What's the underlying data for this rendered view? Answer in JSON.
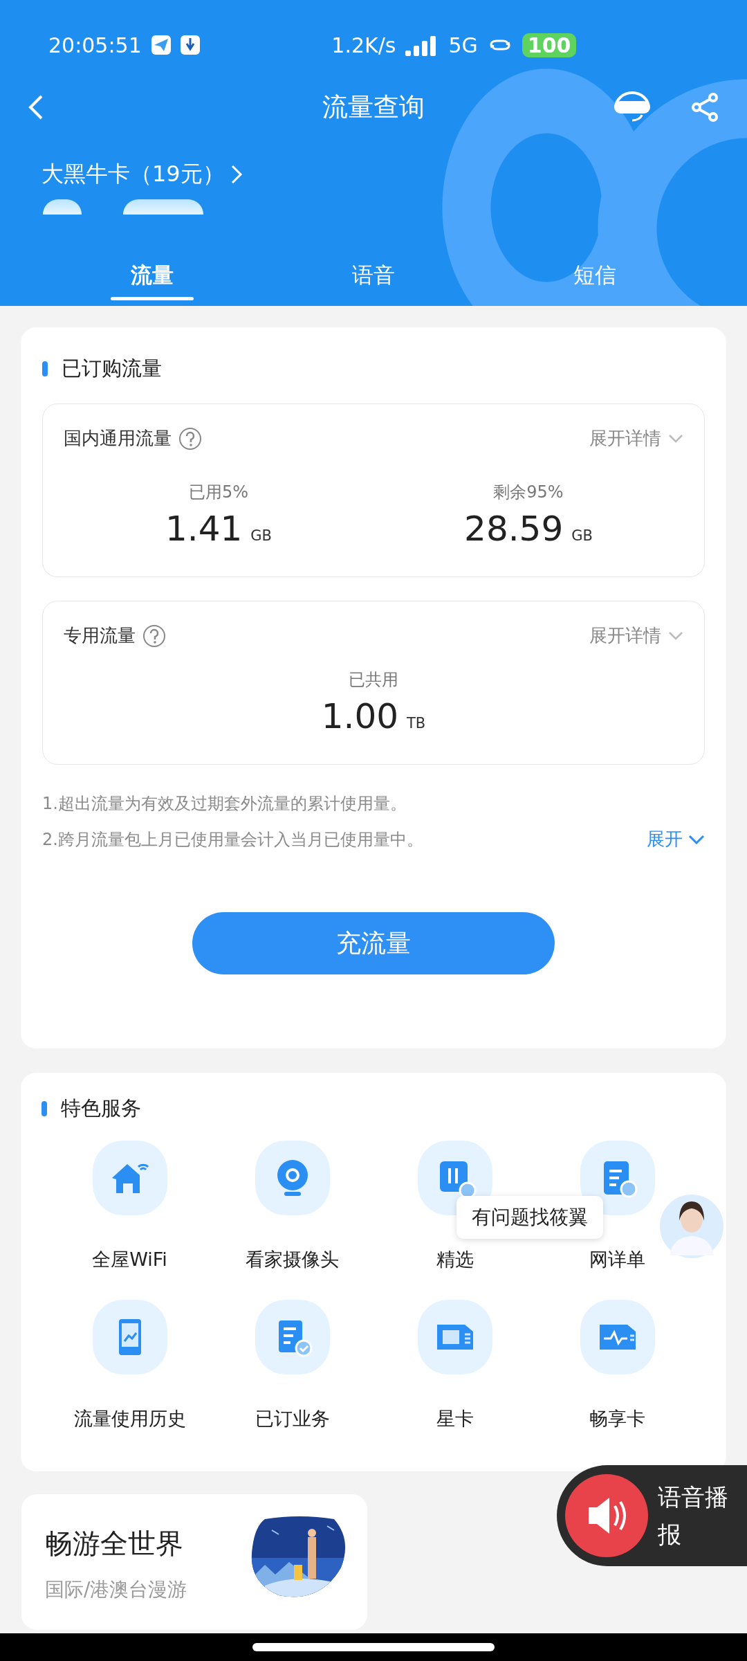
{
  "status_bar": {
    "time": "20:05:51",
    "speed": "1.2K/s",
    "network": "5G",
    "battery": "100"
  },
  "nav": {
    "title": "流量查询"
  },
  "plan": {
    "name": "大黑牛卡（19元）"
  },
  "tabs": [
    {
      "label": "流量",
      "selected": true
    },
    {
      "label": "语音",
      "selected": false
    },
    {
      "label": "短信",
      "selected": false
    }
  ],
  "subscribed": {
    "title": "已订购流量",
    "boxes": [
      {
        "name": "国内通用流量",
        "toggle": "展开详情",
        "stats": [
          {
            "label": "已用5%",
            "value": "1.41",
            "unit": "GB"
          },
          {
            "label": "剩余95%",
            "value": "28.59",
            "unit": "GB"
          }
        ]
      },
      {
        "name": "专用流量",
        "toggle": "展开详情",
        "stats": [
          {
            "label": "已共用",
            "value": "1.00",
            "unit": "TB"
          }
        ]
      }
    ],
    "notes": [
      "1.超出流量为有效及过期套外流量的累计使用量。",
      "2.跨月流量包上月已使用量会计入当月已使用量中。"
    ],
    "expand": "展开",
    "button": "充流量"
  },
  "services": {
    "title": "特色服务",
    "items": [
      {
        "label": "全屋WiFi"
      },
      {
        "label": "看家摄像头"
      },
      {
        "label": "精选"
      },
      {
        "label": "网详单"
      },
      {
        "label": "流量使用历史"
      },
      {
        "label": "已订业务"
      },
      {
        "label": "星卡"
      },
      {
        "label": "畅享卡"
      }
    ]
  },
  "promo": {
    "title": "畅游全世界",
    "subtitle": "国际/港澳台漫游",
    "kind": "picture"
  },
  "assistant": {
    "tooltip": "有问题找筱翼"
  },
  "voice": {
    "label": "语音播报"
  }
}
